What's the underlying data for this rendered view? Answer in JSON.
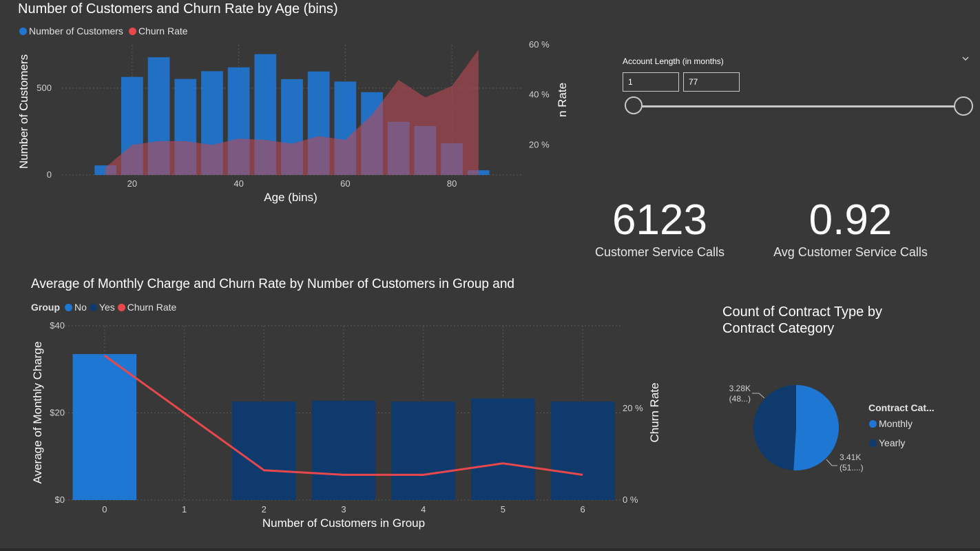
{
  "chart1": {
    "title": "Number of Customers and Churn Rate by Age (bins)",
    "legend": [
      {
        "label": "Number of Customers",
        "color": "#1f77d4"
      },
      {
        "label": "Churn Rate",
        "color": "#e8474c"
      }
    ],
    "xlabel": "Age (bins)",
    "ylabel_left": "Number of Customers",
    "ylabel_right": "n Rate",
    "x_ticks": [
      "20",
      "40",
      "60",
      "80"
    ],
    "y_ticks_left": [
      "0",
      "500"
    ],
    "y_ticks_right": [
      "20 %",
      "40 %",
      "60 %"
    ]
  },
  "slicer": {
    "label": "Account Length (in months)",
    "min_value": "1",
    "max_value": "77",
    "range_fraction": [
      0,
      1
    ]
  },
  "kpis": [
    {
      "value": "6123",
      "label": "Customer Service Calls"
    },
    {
      "value": "0.92",
      "label": "Avg Customer Service Calls"
    }
  ],
  "chart2": {
    "title": "Average of Monthly Charge and Churn Rate by Number of Customers in Group and",
    "legend_title": "Group",
    "legend": [
      {
        "label": "No",
        "color": "#1f77d4"
      },
      {
        "label": "Yes",
        "color": "#0e3a6e"
      },
      {
        "label": "Churn Rate",
        "color": "#e8474c"
      }
    ],
    "xlabel": "Number of Customers in Group",
    "ylabel_left": "Average of Monthly Charge",
    "ylabel_right": "Churn Rate",
    "y_ticks_left": [
      "$0",
      "$20",
      "$40"
    ],
    "y_ticks_right": [
      "0 %",
      "20 %"
    ]
  },
  "pie": {
    "title_line1": "Count of Contract Type by",
    "title_line2": "Contract Category",
    "legend_title": "Contract Cat...",
    "labels": {
      "yearly_1": "3.28K",
      "yearly_2": "(48...)",
      "monthly_1": "3.41K",
      "monthly_2": "(51....)"
    }
  },
  "chart_data": [
    {
      "type": "bar",
      "title": "Number of Customers and Churn Rate by Age (bins)",
      "xlabel": "Age (bins)",
      "ylabel": "Number of Customers",
      "x": [
        15,
        20,
        25,
        30,
        35,
        40,
        45,
        50,
        55,
        60,
        65,
        70,
        75,
        80,
        85
      ],
      "series": [
        {
          "name": "Number of Customers",
          "type": "bar",
          "axis": "left",
          "values": [
            55,
            565,
            678,
            553,
            598,
            620,
            696,
            552,
            596,
            538,
            477,
            306,
            282,
            183,
            27
          ]
        },
        {
          "name": "Churn Rate",
          "type": "area",
          "axis": "right",
          "unit": "%",
          "values": [
            11,
            20,
            21.5,
            21.5,
            20,
            22.5,
            22,
            20.5,
            23.5,
            22,
            32,
            46,
            39,
            43.5,
            58
          ]
        }
      ],
      "xlim": [
        12,
        88
      ],
      "ylim_left": [
        0,
        750
      ],
      "ylim_right": [
        8,
        60
      ]
    },
    {
      "type": "bar",
      "title": "Average of Monthly Charge and Churn Rate by Number of Customers in Group and",
      "xlabel": "Number of Customers in Group",
      "ylabel": "Average of Monthly Charge",
      "categories": [
        "0",
        "1",
        "2",
        "3",
        "4",
        "5",
        "6"
      ],
      "series": [
        {
          "name": "No",
          "type": "bar",
          "values": [
            33.5,
            null,
            null,
            null,
            null,
            null,
            null
          ]
        },
        {
          "name": "Yes",
          "type": "bar",
          "values": [
            null,
            null,
            22.6,
            22.8,
            22.6,
            23.3,
            22.6
          ]
        },
        {
          "name": "Churn Rate",
          "type": "line",
          "axis": "right",
          "unit": "%",
          "values": [
            31.5,
            19,
            6.5,
            5.5,
            5.5,
            8,
            5.5
          ]
        }
      ],
      "ylim_left": [
        0,
        40
      ],
      "ylim_right": [
        0,
        38
      ]
    },
    {
      "type": "pie",
      "title": "Count of Contract Type by Contract Category",
      "categories": [
        "Monthly",
        "Yearly"
      ],
      "values": [
        3410,
        3280
      ],
      "colors": [
        "#1f77d4",
        "#0e3a6e"
      ]
    }
  ]
}
